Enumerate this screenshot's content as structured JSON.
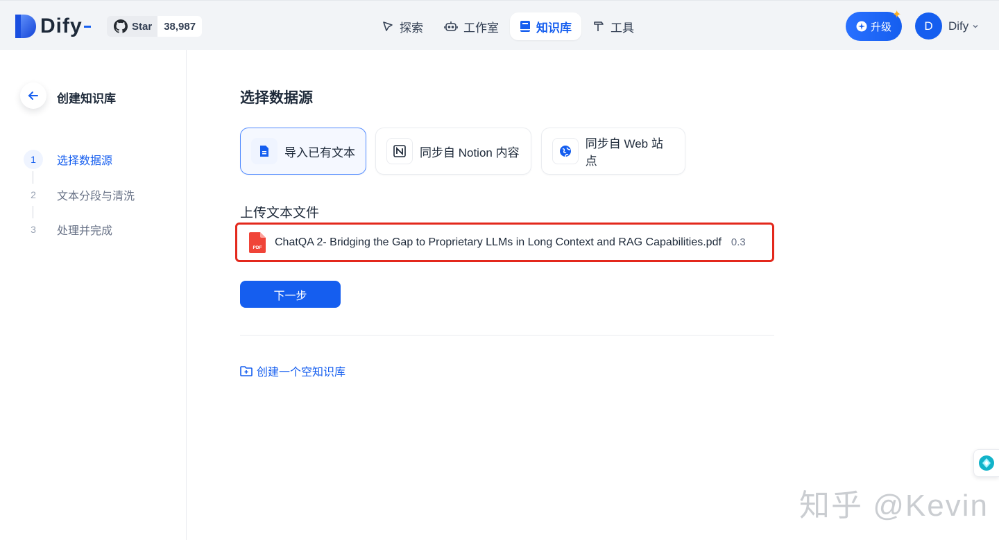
{
  "header": {
    "logo_text": "Dify",
    "github": {
      "star_label": "Star",
      "star_count": "38,987"
    },
    "nav": [
      {
        "label": "探索",
        "icon": "compass-icon"
      },
      {
        "label": "工作室",
        "icon": "robot-icon"
      },
      {
        "label": "知识库",
        "icon": "book-icon",
        "active": true
      },
      {
        "label": "工具",
        "icon": "hammer-icon"
      }
    ],
    "upgrade_label": "升级",
    "avatar_initial": "D",
    "account_name": "Dify"
  },
  "sidebar": {
    "title": "创建知识库",
    "steps": [
      {
        "num": "1",
        "label": "选择数据源",
        "active": true
      },
      {
        "num": "2",
        "label": "文本分段与清洗"
      },
      {
        "num": "3",
        "label": "处理并完成"
      }
    ]
  },
  "main": {
    "title": "选择数据源",
    "sources": [
      {
        "label": "导入已有文本",
        "active": true
      },
      {
        "label": "同步自 Notion 内容"
      },
      {
        "label": "同步自 Web 站点"
      }
    ],
    "upload_title": "上传文本文件",
    "file": {
      "name": "ChatQA 2- Bridging the Gap to Proprietary LLMs in Long Context and RAG Capabilities.pdf",
      "size": "0.3",
      "badge": "PDF"
    },
    "next_label": "下一步",
    "empty_link": "创建一个空知识库"
  },
  "watermark": "知乎 @Kevin",
  "colors": {
    "accent": "#155eef",
    "highlight_border": "#e3281c",
    "pdf_red": "#f04438"
  }
}
